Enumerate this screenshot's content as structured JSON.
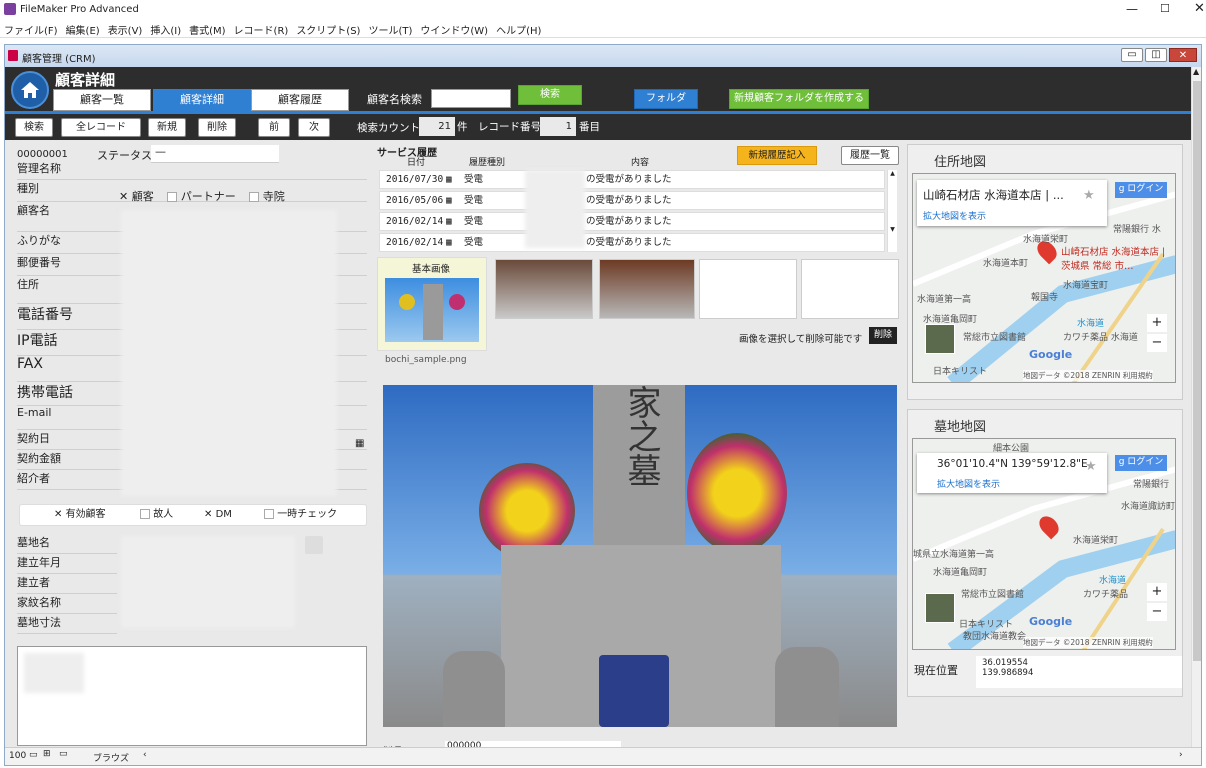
{
  "app": {
    "title": "FileMaker Pro Advanced",
    "menu": [
      "ファイル(F)",
      "編集(E)",
      "表示(V)",
      "挿入(I)",
      "書式(M)",
      "レコード(R)",
      "スクリプト(S)",
      "ツール(T)",
      "ウインドウ(W)",
      "ヘルプ(H)"
    ]
  },
  "window": {
    "title": "顧客管理 (CRM)"
  },
  "header": {
    "title": "顧客詳細",
    "tabs": [
      "顧客一覧",
      "顧客詳細",
      "顧客履歴"
    ],
    "search_label": "顧客名検索",
    "search_btn": "検索",
    "folder_btn": "フォルダ",
    "new_folder_btn": "新規顧客フォルダを作成する"
  },
  "toolbar": {
    "find": "検索",
    "all": "全レコード",
    "new": "新規",
    "delete": "削除",
    "prev": "前",
    "next": "次",
    "count_label": "検索カウント",
    "count": "21",
    "count_unit": "件",
    "record_label": "レコード番号",
    "record": "1",
    "record_unit": "番目"
  },
  "customer": {
    "id": "00000001",
    "status_label": "ステータス",
    "status_value": "—",
    "labels": [
      "管理名称",
      "種別",
      "顧客名",
      "ふりがな",
      "郵便番号",
      "住所",
      "電話番号",
      "IP電話",
      "FAX",
      "携帯電話",
      "E-mail",
      "契約日",
      "契約金額",
      "紹介者"
    ],
    "type_options": [
      "顧客",
      "パートナー",
      "寺院"
    ],
    "flags": [
      "有効顧客",
      "故人",
      "DM",
      "一時チェック"
    ],
    "grave_labels": [
      "墓地名",
      "建立年月",
      "建立者",
      "家紋名称",
      "墓地寸法"
    ]
  },
  "history": {
    "title": "サービス履歴",
    "col_date": "日付",
    "col_type": "履歴種別",
    "col_content": "内容",
    "new_btn": "新規履歴記入",
    "list_btn": "履歴一覧",
    "rows": [
      {
        "date": "2016/07/30",
        "type": "受電",
        "content": "の受電がありました"
      },
      {
        "date": "2016/05/06",
        "type": "受電",
        "content": "の受電がありました"
      },
      {
        "date": "2016/02/14",
        "type": "受電",
        "content": "の受電がありました"
      },
      {
        "date": "2016/02/14",
        "type": "受電",
        "content": "の受電がありました"
      }
    ]
  },
  "images": {
    "base_label": "基本画像",
    "note": "画像を選択して削除可能です",
    "delete_btn": "削除",
    "filename": "bochi_sample.png",
    "kanji": "家之墓"
  },
  "maps": {
    "address_title": "住所地図",
    "address_place": "山崎石材店 水海道本店 | ...",
    "address_link": "拡大地図を表示",
    "login": "ログイン",
    "marker_label": "山崎石材店 水海道本店 | 茨城県 常総 市…",
    "footer": "地図データ ©2018 ZENRIN 利用規約",
    "grave_title": "墓地地図",
    "grave_coord": "36°01'10.4\"N 139°59'12.8\"E",
    "grave_link": "拡大地図を表示",
    "google": "Google",
    "place_labels_1": [
      "常陽銀行 水",
      "水海道栄町",
      "水海道本町",
      "水海道宝町",
      "水海道第一高",
      "報国寺",
      "水海道亀岡町",
      "水海道",
      "常総市立図書館",
      "カワチ薬品 水海道",
      "日本キリスト"
    ],
    "place_labels_2": [
      "常陽銀行",
      "水海道諏訪町",
      "水海道栄町",
      "城県立水海道第一高",
      "水海道亀岡町",
      "水海道",
      "常総市立図書館",
      "カワチ薬品",
      "日本キリスト",
      "教団水海道教会",
      "細本公園"
    ],
    "location_label": "現在位置",
    "lat": "36.019554",
    "lng": "139.986894"
  },
  "status": {
    "zoom": "100",
    "mode": "ブラウズ",
    "order_label": "製品ID",
    "order_value": "000000"
  },
  "colors": {
    "accent": "#2f7fd3",
    "header": "#2d2d2d",
    "green": "#6fbf3b",
    "orange": "#f5a623"
  }
}
